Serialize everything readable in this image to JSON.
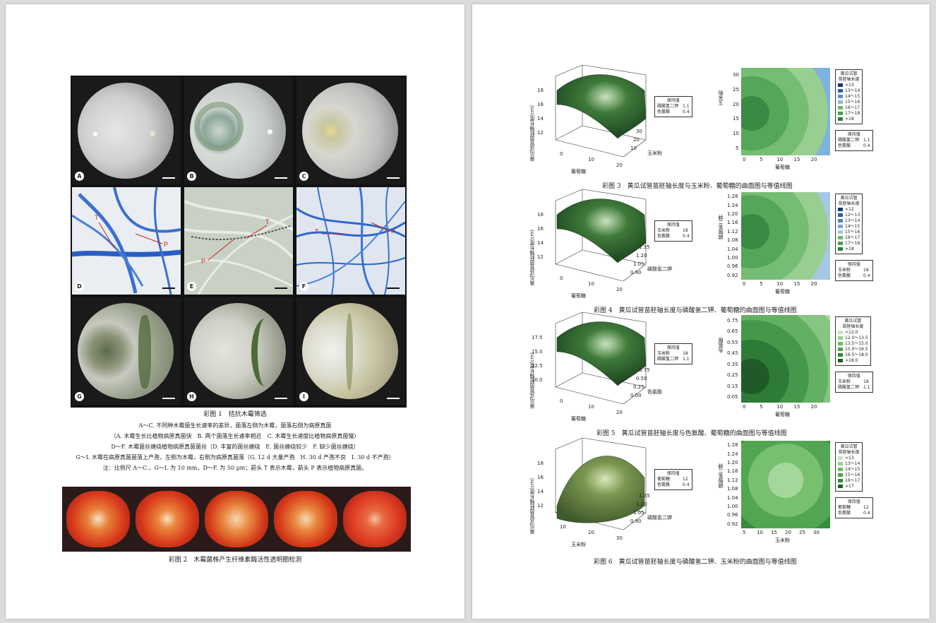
{
  "left": {
    "panel_labels": [
      "A",
      "B",
      "C",
      "D",
      "E",
      "F",
      "G",
      "H",
      "I"
    ],
    "micro_labels": {
      "T": "T",
      "P": "P"
    },
    "fig1": {
      "title": "彩图 1　拮抗木霉筛选",
      "lines": [
        "A～C. 不同种木霉菌生长速率的差异，菌落左侧为木霉，菌落右侧为病原真菌",
        "（A. 木霉生长比植物病原真菌快　B. 两个菌落生长速率相近　C. 木霉生长速度比植物病原真菌慢）",
        "D～F. 木霉菌丝缠绕植物病原真菌菌丝（D. 丰富的菌丝缠绕　E. 菌丝缠绕较少　F. 缺少菌丝缠绕）",
        "G～I. 木霉在病原真菌菌落上产孢，左侧为木霉，右侧为病原真菌落（G. 12 d 大量产孢　H. 30 d 产孢不良　I. 30 d 不产孢）",
        "注：比例尺 A～C.，G～I. 为 10 mm，D～F. 为 50 μm；箭头 T 表示木霉，箭头 P 表示植物病原真菌。"
      ]
    },
    "fig2": {
      "title": "彩图 2　木霉菌株产生纤维素酶活性透明圈检测"
    }
  },
  "right": {
    "figures": [
      {
        "caption": "彩图 3　黄瓜试管苗胚轴长度与玉米粉、葡萄糖的曲面图与等值线图",
        "zlabel": "黄瓜试管苗胚轴长度(cm)",
        "z_ticks": [
          "12",
          "14",
          "16",
          "18"
        ],
        "x_label": "葡萄糖",
        "x_ticks": [
          "0",
          "10",
          "20"
        ],
        "y_label": "玉米粉",
        "y_ticks": [
          "10",
          "20",
          "30"
        ],
        "hold": {
          "title": "保持值",
          "rows": [
            [
              "磷酸氢二钾",
              "1.1"
            ],
            [
              "色氨酸",
              "0.4"
            ]
          ]
        },
        "contour_ylabel": "玉米粉",
        "contour_yticks": [
          "30",
          "25",
          "20",
          "15",
          "10",
          "5"
        ],
        "contour_xlabel": "葡萄糖",
        "contour_xticks": [
          "0",
          "5",
          "10",
          "15",
          "20"
        ],
        "legend_title": "黄瓜试管\n苗胚轴长度",
        "legend_items": [
          "<13",
          "13～14",
          "14～15",
          "15～16",
          "16～17",
          "17～18",
          ">18"
        ],
        "legend_colors": [
          "#123a7a",
          "#2f62a8",
          "#5b90c8",
          "#8fb6dc",
          "#6fb86a",
          "#4f9e4d",
          "#2e7d32"
        ],
        "contour_colors": [
          "#3a8a44",
          "#55a657",
          "#75bd72",
          "#98cf90",
          "#7fb2dc",
          "#4d86c4",
          "#1b3f8a"
        ],
        "hold2": {
          "title": "保持值",
          "rows": [
            [
              "磷酸氢二钾",
              "1.1"
            ],
            [
              "色氨酸",
              "0.4"
            ]
          ]
        }
      },
      {
        "caption": "彩图 4　黄瓜试管苗胚轴长度与磷酸氢二钾、葡萄糖的曲面图与等值线图",
        "zlabel": "黄瓜试管苗胚轴长度(cm)",
        "z_ticks": [
          "12",
          "14",
          "16",
          "18"
        ],
        "x_label": "葡萄糖",
        "x_ticks": [
          "0",
          "10",
          "20"
        ],
        "y_label": "磷酸氢二钾",
        "y_ticks": [
          "0.90",
          "1.05",
          "1.20",
          "1.35"
        ],
        "hold": {
          "title": "保持值",
          "rows": [
            [
              "玉米粉",
              "18"
            ],
            [
              "色氨酸",
              "0.4"
            ]
          ]
        },
        "contour_ylabel": "磷酸氢二钾",
        "contour_yticks": [
          "1.28",
          "1.24",
          "1.20",
          "1.16",
          "1.12",
          "1.08",
          "1.04",
          "1.00",
          "0.96",
          "0.92"
        ],
        "contour_xlabel": "葡萄糖",
        "contour_xticks": [
          "0",
          "5",
          "10",
          "15",
          "20"
        ],
        "legend_title": "黄瓜试管\n苗胚轴长度",
        "legend_items": [
          "<12",
          "12～13",
          "13～14",
          "14～15",
          "15～16",
          "16～17",
          "17～18",
          ">18"
        ],
        "legend_colors": [
          "#123a7a",
          "#2a5ca0",
          "#4d80c0",
          "#7aa6d6",
          "#a6c8e6",
          "#6fb86a",
          "#4f9e4d",
          "#2e7d32"
        ],
        "contour_colors": [
          "#3a8a44",
          "#55a657",
          "#75bd72",
          "#98cf90",
          "#a6c8e6",
          "#6d9fd2",
          "#3c70b6"
        ],
        "hold2": {
          "title": "保持值",
          "rows": [
            [
              "玉米粉",
              "18"
            ],
            [
              "色氨酸",
              "0.4"
            ]
          ]
        }
      },
      {
        "caption": "彩图 5　黄瓜试管苗胚轴长度与色氨酸、葡萄糖的曲面图与等值线图",
        "zlabel": "黄瓜试管苗胚轴长度(cm)",
        "z_ticks": [
          "10.0",
          "12.5",
          "15.0",
          "17.5"
        ],
        "x_label": "葡萄糖",
        "x_ticks": [
          "0",
          "10",
          "20"
        ],
        "y_label": "色氨酸",
        "y_ticks": [
          "0.00",
          "0.25",
          "0.50",
          "0.75"
        ],
        "hold": {
          "title": "保持值",
          "rows": [
            [
              "玉米粉",
              "18"
            ],
            [
              "磷酸氢二钾",
              "1.1"
            ]
          ]
        },
        "contour_ylabel": "色氨酸",
        "contour_yticks": [
          "0.75",
          "0.65",
          "0.55",
          "0.45",
          "0.35",
          "0.25",
          "0.15",
          "0.05"
        ],
        "contour_xlabel": "葡萄糖",
        "contour_xticks": [
          "0",
          "5",
          "10",
          "15",
          "20"
        ],
        "legend_title": "黄瓜试管\n苗胚轴长度",
        "legend_items": [
          "<12.0",
          "12.0～13.5",
          "13.5～15.0",
          "15.0～16.5",
          "16.5～18.0",
          ">18.0"
        ],
        "legend_colors": [
          "#c3e6bd",
          "#98d092",
          "#6dbb67",
          "#4aa44a",
          "#2e8a37",
          "#1b5e27"
        ],
        "contour_colors": [
          "#1f5a28",
          "#2e7a37",
          "#45974a",
          "#64b062",
          "#86c682",
          "#b2dca9"
        ],
        "hold2": {
          "title": "保持值",
          "rows": [
            [
              "玉米粉",
              "18"
            ],
            [
              "磷酸氢二钾",
              "1.1"
            ]
          ]
        }
      },
      {
        "caption": "彩图 6　黄瓜试管苗胚轴长度与磷酸氢二钾、玉米粉的曲面图与等值线图",
        "zlabel": "黄瓜试管苗胚轴长度(cm)",
        "z_ticks": [
          "12",
          "14",
          "16",
          "18"
        ],
        "x_label": "玉米粉",
        "x_ticks": [
          "10",
          "20",
          "30"
        ],
        "y_label": "磷酸氢二钾",
        "y_ticks": [
          "0.90",
          "1.05",
          "1.20",
          "1.35"
        ],
        "hold": {
          "title": "保持值",
          "rows": [
            [
              "葡萄糖",
              "12"
            ],
            [
              "色氨酸",
              "0.4"
            ]
          ]
        },
        "contour_ylabel": "磷酸氢二钾",
        "contour_yticks": [
          "1.28",
          "1.24",
          "1.20",
          "1.16",
          "1.12",
          "1.08",
          "1.04",
          "1.00",
          "0.96",
          "0.92"
        ],
        "contour_xlabel": "玉米粉",
        "contour_xticks": [
          "5",
          "10",
          "15",
          "20",
          "25",
          "30"
        ],
        "legend_title": "黄瓜试管\n苗胚轴长度",
        "legend_items": [
          "<13",
          "13～14",
          "14～15",
          "15～16",
          "16～17",
          ">17"
        ],
        "legend_colors": [
          "#c3e6bd",
          "#98d092",
          "#6dbb67",
          "#4aa44a",
          "#2e8a37",
          "#1b5e27"
        ],
        "contour_colors": [
          "#a3d89a",
          "#77c070",
          "#52a653",
          "#378c3d",
          "#256e2e",
          "#1a5a24"
        ],
        "hold2": {
          "title": "保持值",
          "rows": [
            [
              "葡萄糖",
              "12"
            ],
            [
              "色氨酸",
              "0.4"
            ]
          ]
        }
      }
    ]
  }
}
